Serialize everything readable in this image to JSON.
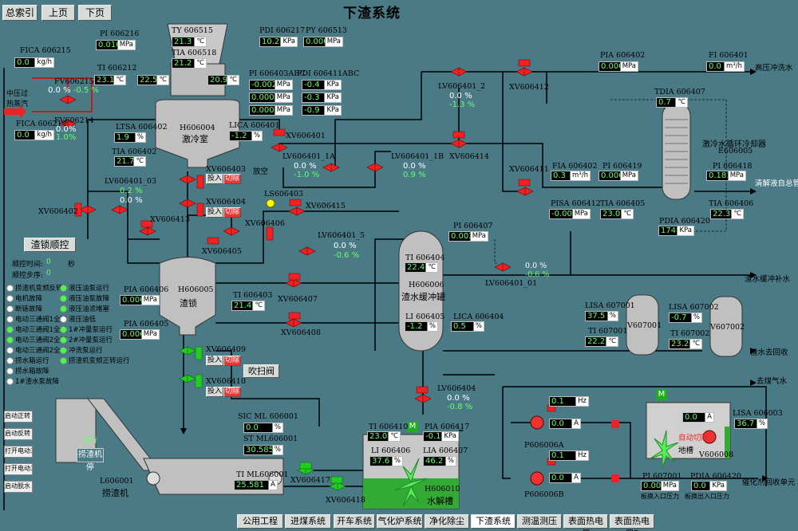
{
  "nav": {
    "index": "总索引",
    "prev": "上页",
    "next": "下页",
    "title": "下渣系统"
  },
  "bottom": [
    "公用工程",
    "进煤系统",
    "开车系统",
    "气化炉系统",
    "净化除尘",
    "下渣系统",
    "测温测压",
    "表面热电偶",
    "表面热电偶2"
  ],
  "tags": {
    "fica606215": "FICA 606215",
    "fica606215_v": "0.0",
    "fica606215_u": "kg/h",
    "fv606215": "FV606215",
    "fv606215_p1": "0.0",
    "fv606215_p2": "-0.5",
    "steam": "中压过热蒸汽",
    "fica606214": "FICA 606214",
    "fica606214_v": "0.0",
    "fica606214_u": "kg/h",
    "fv606214": "FV606214",
    "fv606214_p1": "0.0",
    "fv606214_p2": "1.0",
    "pi606216": "PI 606216",
    "pi606216_v": "0.010",
    "pi606216_u": "MPa",
    "ti606212": "TI 606212",
    "ti606212_v": "23.1",
    "ti606212_u": "℃",
    "t22": "22.5",
    "t22_u": "℃",
    "ty606515": "TY 606515",
    "ty606515_v": "21.3",
    "ty606515_u": "℃",
    "tia606518": "TIA 606518",
    "tia606518_v": "21.2",
    "tia606518_u": "℃",
    "t209": "20.9",
    "t209_u": "℃",
    "pdi606217": "PDI 606217",
    "pdi606217_v": "10.2",
    "pdi606217_u": "KPa",
    "py606513": "PY 606513",
    "py606513_v": "0.000",
    "py606513_u": "MPa",
    "pi606403": "PI 606403ABC",
    "pi606403_a": "-0.002",
    "pi606403_b": "0.000",
    "pi606403_c": "0.000",
    "pi606403_u": "MPa",
    "pdi606411": "PDI 606411ABC",
    "pdi606411_a": "-0.4",
    "pdi606411_b": "-0.3",
    "pdi606411_c": "-0.9",
    "pdi606411_u": "KPa",
    "h606004": "H606004",
    "quench": "激冷室",
    "ltsa606402": "LTSA 606402",
    "ltsa606402_v": "1.9",
    "ltsa606402_u": "%",
    "lica606401": "LICA 606401",
    "lica606401_v": "-1.2",
    "lica606401_u": "%",
    "xv606401": "XV606401",
    "tia606402": "TIA 606402",
    "tia606402_v": "21.7",
    "tia606402_u": "℃",
    "lv606401_2": "LV606401_2",
    "lv606401_2_p1": "0.0",
    "lv606401_2_p2": "-1.3",
    "xv606412": "XV606412",
    "pia606402": "PIA 606402",
    "pia606402_v": "0.000",
    "pia606402_u": "MPa",
    "fi606401": "FI 606401",
    "fi606401_v": "0.0",
    "fi606401_u": "m³/h",
    "hpwater": "高压冲洗水",
    "lv606401_1a": "LV606401_1A",
    "lv606401_1a_p1": "0.0",
    "lv606401_1a_p2": "-1.0",
    "lv606401_1b": "LV606401_1B",
    "lv606401_1b_p1": "0.0",
    "lv606401_1b_p2": "0.9",
    "xv606414": "XV606414",
    "tdia606407": "TDIA 606407",
    "tdia606407_v": "0.7",
    "tdia606407_u": "℃",
    "coolername": "激冷水循环冷却器",
    "e606005": "E606005",
    "lv606401_03": "LV606401_03",
    "lv606401_03_p1": "0.2",
    "lv606401_03_p2": "0.0",
    "xv606402": "XV606402",
    "xv606413": "XV606413",
    "xv606403": "XV606403",
    "xv606404": "XV606404",
    "xv606405": "XV606405",
    "xv606406": "XV606406",
    "touru": "投入",
    "qiechu": "切除",
    "fangkong": "放空",
    "ls606403": "LS606403",
    "xv606415": "XV606415",
    "fia606402": "FIA 606402",
    "fia606402_v": "0.3",
    "fia606402_u": "m³/h",
    "pi606419": "PI 606419",
    "pi606419_v": "0.006",
    "pi606419_u": "MPa",
    "pi606418": "PI 606418",
    "pi606418_v": "0.181",
    "pi606418_u": "MPa",
    "xv606411": "XV606411",
    "pisa606412": "PISA 606412",
    "pisa606412_v": "-0.001",
    "pisa606412_u": "MPa",
    "tia606405": "TIA 606405",
    "tia606405_v": "23.0",
    "tia606405_u": "℃",
    "tia606406": "TIA 606406",
    "tia606406_v": "22.3",
    "tia606406_u": "℃",
    "pdia606420": "PDIA 606420",
    "pdia606420_v": "174.6",
    "pdia606420_u": "KPa",
    "qingjie": "清解液自总管",
    "slagctl": "渣锁顺控",
    "pi606407": "PI 606407",
    "pi606407_v": "0.002",
    "pi606407_u": "MPa",
    "lv606401_5": "LV606401_5",
    "lv606401_5_p1": "0.0",
    "lv606401_5_p2": "-0.6",
    "steptime": "顺控时间:",
    "steptime_v": "0",
    "steptime_u": "秒",
    "stepno": "顺控步序:",
    "stepno_v": "0",
    "ti606404": "TI 606404",
    "ti606404_v": "22.4",
    "ti606404_u": "℃",
    "lv606401_01": "LV606401_01",
    "lv606401_01_p1": "0.0",
    "lv606401_01_p2": "-0.6",
    "slagwater": "渣水缓冲补水",
    "h606006": "H606006",
    "buffer": "渣水缓冲罐",
    "pia606406": "PIA 606406",
    "pia606406_v": "0.006",
    "pia606406_u": "MPa",
    "h606005": "H606005",
    "slaglock": "渣锁",
    "ti606403": "TI 606403",
    "ti606403_v": "21.4",
    "ti606403_u": "℃",
    "xv606407": "XV606407",
    "lisa607001": "LISA 607001",
    "lisa607001_v": "37.5",
    "lisa607001_u": "%",
    "lisa607002": "LISA 607002",
    "lisa607002_v": "-0.7",
    "lisa607002_u": "%",
    "v607001": "V607001",
    "v607002": "V607002",
    "ti607001": "TI 607001",
    "ti607001_v": "22.2",
    "ti607001_u": "℃",
    "ti607002": "TI 607002",
    "ti607002_v": "23.2",
    "ti607002_u": "℃",
    "pia606405": "PIA 606405",
    "pia606405_v": "0.006",
    "pia606405_u": "MPa",
    "li606405": "LI 606405",
    "li606405_v": "-1.2",
    "li606405_u": "%",
    "lica606404": "LICA 606404",
    "lica606404_v": "0.5",
    "lica606404_u": "%",
    "xv606408": "XV606408",
    "slagreturn": "渣水去回收",
    "xv606409": "XV606409",
    "xv606410": "XV606410",
    "chuisao": "吹扫阀",
    "coalgas": "去煤气水",
    "lv606404": "LV606404",
    "lv606404_p1": "0.0",
    "lv606404_p2": "-0.8",
    "hz1": "0.1",
    "hz1_u": "Hz",
    "a1": "0.0",
    "a1_u": "A",
    "p606006a": "P606006A",
    "hz2": "0.1",
    "hz2_u": "Hz",
    "a2": "0.0",
    "a2_u": "A",
    "p606006b": "P606006B",
    "sic606001": "SIC ML 606001",
    "sic606001_v": "0.0",
    "sic606001_u": "%",
    "st606001": "ST ML606001",
    "st606001_v": "30.585",
    "st606001_u": "%",
    "ti606410": "TI 606410",
    "ti606410_v": "23.0",
    "ti606410_u": "℃",
    "pia606417": "PIA 606417",
    "pia606417_v": "-0.1",
    "pia606417_u": "KPa",
    "li606406": "LI 606406",
    "li606406_v": "37.6",
    "li606406_u": "%",
    "lia606407": "LIA 606407",
    "lia606407_v": "46.2",
    "lia606407_u": "%",
    "h606010": "H606010",
    "decomp": "水解槽",
    "lisa606003": "LISA 606003",
    "lisa606003_v": "36.7",
    "lisa606003_u": "%",
    "sumpA": "0.0",
    "sumpA_u": "A",
    "autocut": "自动切除",
    "ditank": "地槽",
    "v606008": "V606008",
    "pi607001": "PI 607001",
    "pi607001_v": "0.00",
    "pi607001_u": "MPa",
    "pi607001_d": "板换入口压力",
    "pdia606420b": "PDIA 606420",
    "pdia606420b_v": "0.0",
    "pdia606420b_u": "KPa",
    "pdia606420b_d": "板换出入口压力",
    "recover": "催化剂回收单元",
    "l606001": "L606001",
    "scraper": "捞渣机",
    "ti_ml": "TI ML606001",
    "ti_ml_v": "25.581",
    "ti_ml_u": "A",
    "xv606417": "XV606417",
    "xv606418": "XV606418",
    "yunxing": "运行",
    "laozha": "捞渣机停"
  },
  "legend_left": [
    "捞渣机变频反转",
    "电机故障",
    "断链故障",
    "电动三通阀1全开",
    "电动三通阀1全关",
    "电动三通阀2全开",
    "电动三通阀2全关",
    "捞水箱运行",
    "捞水箱故障",
    "1#渣水泵故障"
  ],
  "legend_right": [
    "液压油泵运行",
    "液压油泵故障",
    "液压油滤堵塞",
    "液压油低",
    "1#冲量泵运行",
    "2#冲量泵运行",
    "冲洗泵运行",
    "捞渣机变频正转运行"
  ],
  "legend_right_green": [
    true,
    true,
    true,
    false,
    true,
    true,
    true,
    true
  ],
  "legend_left_green": [
    false,
    false,
    false,
    false,
    true,
    true,
    false,
    false,
    false,
    false
  ],
  "side_buttons": [
    "启动正转",
    "启动反转",
    "打开电动三通阀1",
    "打开电动三通阀2",
    "启动脱水"
  ]
}
